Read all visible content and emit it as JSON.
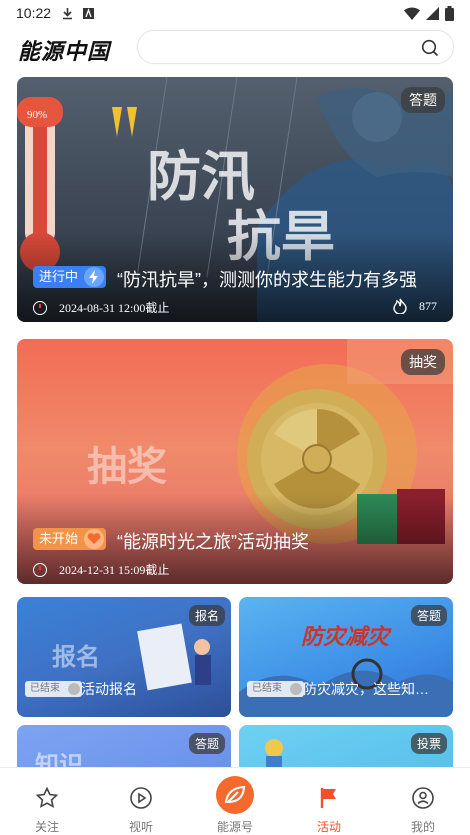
{
  "status_bar": {
    "time": "10:22"
  },
  "header": {
    "logo": "能源中国",
    "search_placeholder": ""
  },
  "cards_big": [
    {
      "tag": "答题",
      "status": "进行中",
      "title": "“防汛抗旱”，测测你的求生能力有多强",
      "deadline": "2024-08-31 12:00截止",
      "hot_count": "877",
      "thermo_label": "90%",
      "big_words": [
        "防汛",
        "抗旱"
      ]
    },
    {
      "tag": "抽奖",
      "status": "未开始",
      "title": "“能源时光之旅”活动抽奖",
      "deadline": "2024-12-31 15:09截止",
      "big_words": [
        "抽奖"
      ]
    }
  ],
  "cards_small": [
    {
      "tag": "报名",
      "status": "已结束",
      "title": "活动报名",
      "big_word": "报名"
    },
    {
      "tag": "答题",
      "status": "已结束",
      "title": "防灾减灾，这些知…",
      "big_word": "防灾减灾"
    },
    {
      "tag": "答题",
      "big_word": "知识"
    },
    {
      "tag": "投票"
    }
  ],
  "tabs": [
    {
      "label": "关注",
      "icon": "star-icon"
    },
    {
      "label": "视听",
      "icon": "play-icon"
    },
    {
      "label": "能源号",
      "icon": "leaf-icon"
    },
    {
      "label": "活动",
      "icon": "flag-icon"
    },
    {
      "label": "我的",
      "icon": "user-icon"
    }
  ],
  "colors": {
    "accent": "#f0512a",
    "blue_pill": "#3b7ff2",
    "orange_pill": "#f29447"
  }
}
